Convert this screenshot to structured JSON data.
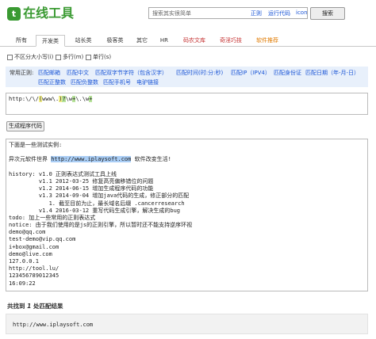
{
  "header": {
    "logo_icon_char": "t",
    "logo_text": "在线工具",
    "search_placeholder": "搜索其实很简单",
    "quick_links": [
      "正则",
      "运行代码",
      "icon"
    ],
    "search_button": "搜索"
  },
  "tabs": [
    {
      "label": "所有",
      "active": false
    },
    {
      "label": "开发类",
      "active": true
    },
    {
      "label": "站长类",
      "active": false
    },
    {
      "label": "极客类",
      "active": false
    },
    {
      "label": "其它",
      "active": false
    },
    {
      "label": "HR",
      "active": false
    },
    {
      "label": "码农文库",
      "active": false
    },
    {
      "label": "奇淫巧技",
      "active": false
    },
    {
      "label": "软件推荐",
      "active": false
    }
  ],
  "options": {
    "ignore_case": "不区分大小写(i)",
    "multiline": "多行(m)",
    "single_line": "单行(s)"
  },
  "regex_panel": {
    "label": "常用正则:",
    "row1": [
      "匹配邮箱",
      "匹配中文",
      "匹配双字节字符（包含汉字）",
      "匹配时间(时:分:秒)",
      "匹配IP（IPV4）",
      "匹配身份证",
      "匹配日期（年-月-日）"
    ],
    "row2": [
      "匹配正整数",
      "匹配负整数",
      "匹配手机号",
      "电驴链接"
    ]
  },
  "regex_input": {
    "p1": "http:\\/\\/",
    "p2": "(",
    "p3": "www\\.",
    "p4": ")",
    "p5": "?",
    "p6": "\\w",
    "p7": "+",
    "p8": "\\.",
    "p9": "\\w",
    "p10": "+"
  },
  "generate_button": "生成程序代码",
  "test_text": {
    "line1": "下面是一些测试实例:",
    "line2": "",
    "line3_before": "异次元软件世界 ",
    "line3_match": "http://www.iplaysoft.com",
    "line3_after": " 软件改变生活!",
    "line4": "",
    "line5": "history: v1.0 正则表达式测试工具上线",
    "line6": "         v1.1 2012-03-25 修复高亮偏移错位的问题",
    "line7": "         v1.2 2014-06-15 增加生成程序代码的功能",
    "line8": "         v1.3 2014-09-04 增加java代码的生成，修正部分的匹配",
    "line9": "            1. 截至目前为止，最长域名后缀 .cancerresearch",
    "line10": "         v1.4 2016-03-12 重写代码生成引擎，解决生成的bug",
    "line11": "todo: 加上一些常用的正则表达式",
    "line12": "notice: 由于我们使用的是js的正则引擎，所以暂时还不能支持逆序环视",
    "line13": "demo@qq.com",
    "line14": "test-demo@vip.qq.com",
    "line15": "i+box@gmail.com",
    "line16": "demo@live.com",
    "line17": "127.0.0.1",
    "line18": "http://tool.lu/",
    "line19": "123456789012345",
    "line20": "16:09:22"
  },
  "result": {
    "title_prefix": "共找到 ",
    "count": "1",
    "title_suffix": " 处匹配结果",
    "match": "http://www.iplaysoft.com"
  },
  "colors": {
    "brand_green": "#3a9a32",
    "link_blue": "#1a55d6",
    "panel_bg": "#e8f0fb",
    "match_highlight": "#a9cdf5"
  }
}
